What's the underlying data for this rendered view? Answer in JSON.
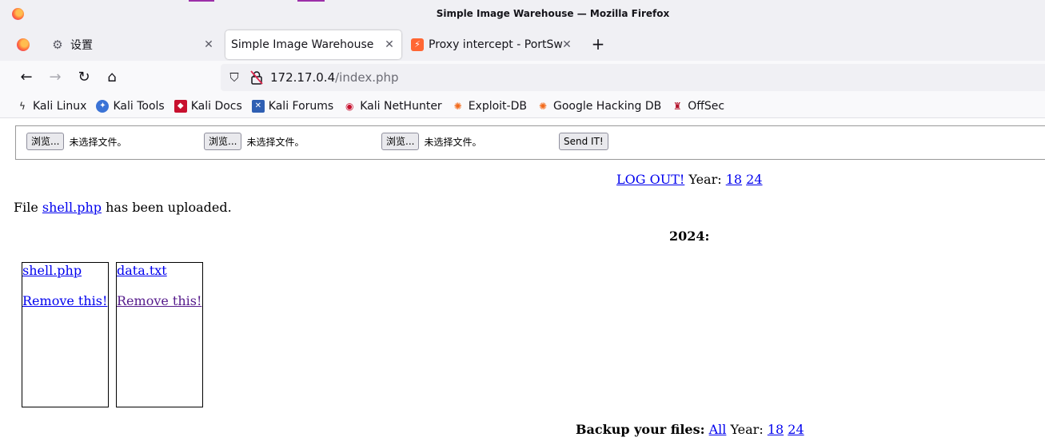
{
  "window": {
    "title": "Simple Image Warehouse — Mozilla Firefox"
  },
  "tabs": [
    {
      "label": "设置",
      "icon": "gear-icon"
    },
    {
      "label": "Simple Image Warehouse",
      "active": true
    },
    {
      "label": "Proxy intercept - PortSwigger",
      "icon": "burp-icon"
    }
  ],
  "address_bar": {
    "host": "172.17.0.4",
    "path": "/index.php"
  },
  "bookmarks": [
    {
      "label": "Kali Linux",
      "icon": "kali-dragon-icon"
    },
    {
      "label": "Kali Tools",
      "icon": "kali-tools-icon"
    },
    {
      "label": "Kali Docs",
      "icon": "kali-docs-icon"
    },
    {
      "label": "Kali Forums",
      "icon": "kali-forums-icon"
    },
    {
      "label": "Kali NetHunter",
      "icon": "nethunter-icon"
    },
    {
      "label": "Exploit-DB",
      "icon": "exploitdb-icon"
    },
    {
      "label": "Google Hacking DB",
      "icon": "ghdb-icon"
    },
    {
      "label": "OffSec",
      "icon": "offsec-icon"
    }
  ],
  "page": {
    "upload_form": {
      "browse_label": "浏览...",
      "no_file_label": "未选择文件。",
      "submit_label": "Send IT!"
    },
    "logout": {
      "link": "LOG OUT!",
      "year_label": "Year:",
      "years": [
        "18",
        "24"
      ]
    },
    "upload_message": {
      "prefix": "File",
      "filename": "shell.php",
      "suffix": "has been uploaded."
    },
    "year_heading": "2024:",
    "files": [
      {
        "name": "shell.php",
        "remove_label": "Remove this!"
      },
      {
        "name": "data.txt",
        "remove_label": "Remove this!"
      }
    ],
    "backup": {
      "label": "Backup your files:",
      "all_link": "All",
      "year_label": "Year:",
      "years": [
        "18",
        "24"
      ]
    }
  },
  "colors": {
    "link": "#0000ee",
    "visited_link": "#551a8b",
    "chrome_bg": "#f0f0f4"
  }
}
